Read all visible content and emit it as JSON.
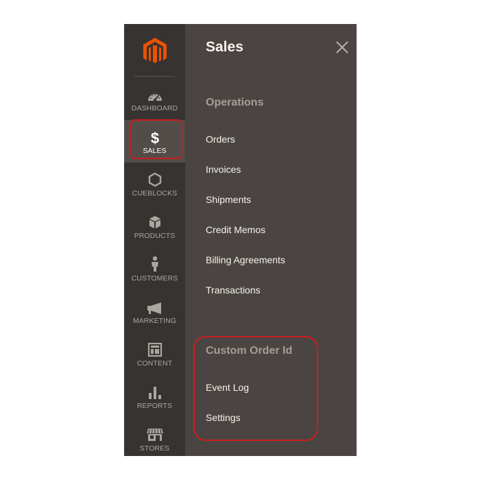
{
  "nav": {
    "logo_icon": "magento-logo",
    "items": [
      {
        "label": "Dashboard",
        "icon": "dashboard-icon"
      },
      {
        "label": "Sales",
        "icon": "dollar-icon",
        "active": true
      },
      {
        "label": "CueBlocks",
        "icon": "hexagon-icon"
      },
      {
        "label": "Products",
        "icon": "box-icon"
      },
      {
        "label": "Customers",
        "icon": "person-icon"
      },
      {
        "label": "Marketing",
        "icon": "megaphone-icon"
      },
      {
        "label": "Content",
        "icon": "layout-icon"
      },
      {
        "label": "Reports",
        "icon": "bar-chart-icon"
      },
      {
        "label": "Stores",
        "icon": "store-icon"
      }
    ]
  },
  "panel": {
    "title": "Sales",
    "sections": [
      {
        "title": "Operations",
        "links": [
          "Orders",
          "Invoices",
          "Shipments",
          "Credit Memos",
          "Billing Agreements",
          "Transactions"
        ]
      },
      {
        "title": "Custom Order Id",
        "links": [
          "Event Log",
          "Settings"
        ]
      }
    ]
  },
  "colors": {
    "nav_bg": "#373330",
    "panel_bg": "#4a4542",
    "logo_orange": "#eb5202",
    "highlight_red": "#d01b20"
  }
}
